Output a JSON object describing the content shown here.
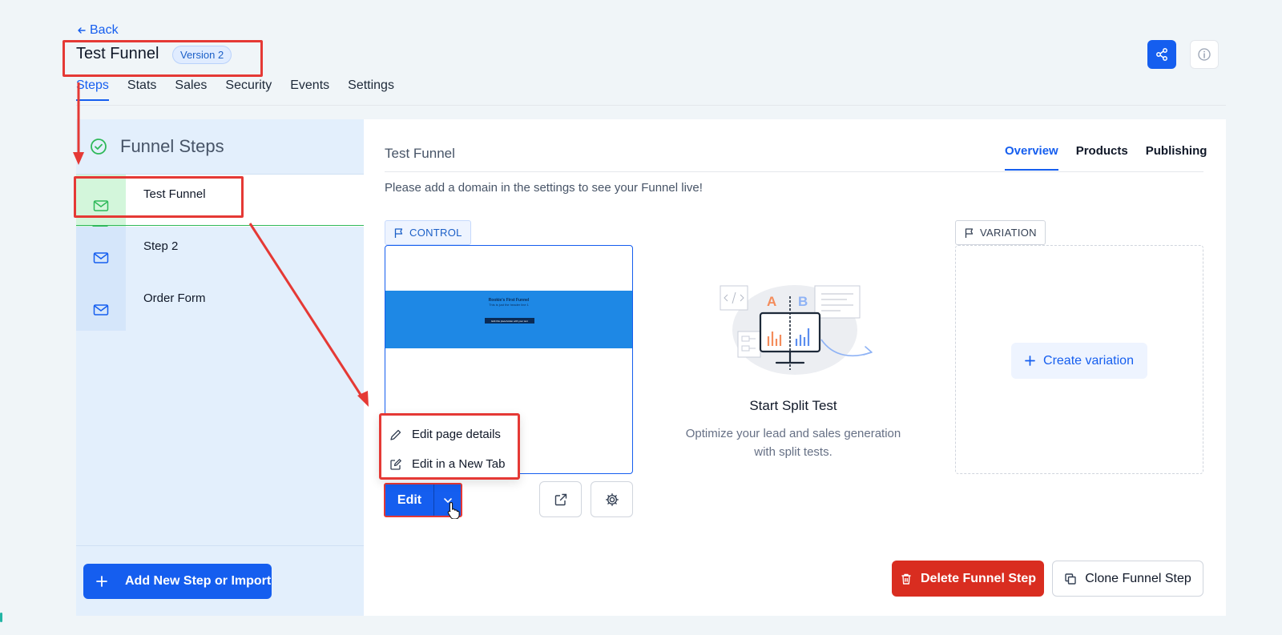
{
  "header": {
    "back_label": "Back",
    "title": "Test Funnel",
    "version_badge": "Version 2",
    "tabs": [
      {
        "label": "Steps",
        "active": true
      },
      {
        "label": "Stats",
        "active": false
      },
      {
        "label": "Sales",
        "active": false
      },
      {
        "label": "Security",
        "active": false
      },
      {
        "label": "Events",
        "active": false
      },
      {
        "label": "Settings",
        "active": false
      }
    ]
  },
  "sidebar": {
    "title": "Funnel Steps",
    "steps": [
      {
        "label": "Test Funnel",
        "active": true
      },
      {
        "label": "Step 2",
        "active": false
      },
      {
        "label": "Order Form",
        "active": false
      }
    ],
    "add_button_label": "Add New Step or Import"
  },
  "main": {
    "title": "Test Funnel",
    "tabs": [
      {
        "label": "Overview",
        "active": true
      },
      {
        "label": "Products",
        "active": false
      },
      {
        "label": "Publishing",
        "active": false
      }
    ],
    "notice": "Please add a domain in the settings to see your Funnel live!",
    "control": {
      "badge": "CONTROL",
      "preview": {
        "headline": "Rookie's First Funnel",
        "subline": "This is just the header line 1",
        "button": "Edit this placeholder with your text"
      },
      "edit_label": "Edit",
      "dropdown_items": [
        "Edit page details",
        "Edit in a New Tab"
      ]
    },
    "split_test": {
      "title": "Start Split Test",
      "subtitle_line1": "Optimize your lead and sales generation",
      "subtitle_line2": "with split tests.",
      "illustration_letter_a": "A",
      "illustration_letter_b": "B"
    },
    "variation": {
      "badge": "VARIATION",
      "create_label": "Create variation"
    },
    "delete_label": "Delete Funnel Step",
    "clone_label": "Clone Funnel Step"
  },
  "colors": {
    "primary": "#155eef",
    "success": "#2fb95a",
    "danger": "#d92d20",
    "annotation": "#e53935",
    "page_background": "#f0f5f8"
  }
}
